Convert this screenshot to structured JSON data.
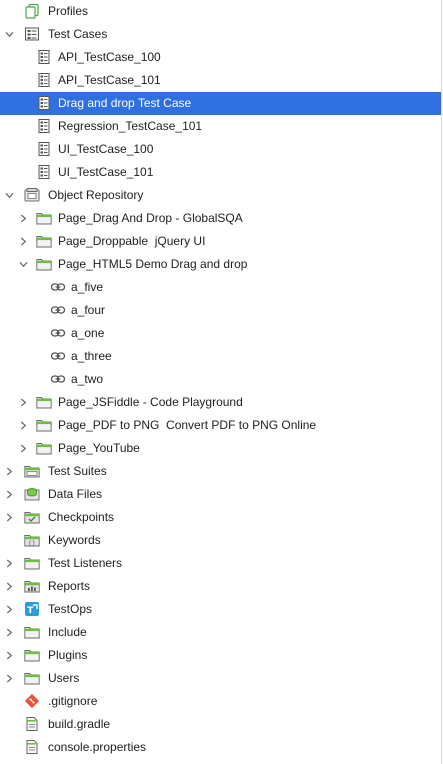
{
  "selection_color": "#2f6fe0",
  "tree": [
    {
      "label": "Profiles",
      "icon": "profiles-icon",
      "level": 0,
      "chevron": "none"
    },
    {
      "label": "Test Cases",
      "icon": "test-cases-folder-icon",
      "level": 0,
      "chevron": "down"
    },
    {
      "label": "API_TestCase_100",
      "icon": "test-case-icon",
      "level": 1,
      "chevron": "none"
    },
    {
      "label": "API_TestCase_101",
      "icon": "test-case-icon",
      "level": 1,
      "chevron": "none"
    },
    {
      "label": "Drag and drop Test Case",
      "icon": "test-case-icon",
      "level": 1,
      "chevron": "none",
      "selected": true
    },
    {
      "label": "Regression_TestCase_101",
      "icon": "test-case-icon",
      "level": 1,
      "chevron": "none"
    },
    {
      "label": "UI_TestCase_100",
      "icon": "test-case-icon",
      "level": 1,
      "chevron": "none"
    },
    {
      "label": "UI_TestCase_101",
      "icon": "test-case-icon",
      "level": 1,
      "chevron": "none"
    },
    {
      "label": "Object Repository",
      "icon": "object-repository-icon",
      "level": 0,
      "chevron": "down"
    },
    {
      "label": "Page_Drag And Drop - GlobalSQA",
      "icon": "folder-icon",
      "level": 1,
      "chevron": "right"
    },
    {
      "label": "Page_Droppable  jQuery UI",
      "icon": "folder-icon",
      "level": 1,
      "chevron": "right"
    },
    {
      "label": "Page_HTML5 Demo Drag and drop",
      "icon": "folder-icon",
      "level": 1,
      "chevron": "down"
    },
    {
      "label": "a_five",
      "icon": "link-icon",
      "level": 2,
      "chevron": "none"
    },
    {
      "label": "a_four",
      "icon": "link-icon",
      "level": 2,
      "chevron": "none"
    },
    {
      "label": "a_one",
      "icon": "link-icon",
      "level": 2,
      "chevron": "none"
    },
    {
      "label": "a_three",
      "icon": "link-icon",
      "level": 2,
      "chevron": "none"
    },
    {
      "label": "a_two",
      "icon": "link-icon",
      "level": 2,
      "chevron": "none"
    },
    {
      "label": "Page_JSFiddle - Code Playground",
      "icon": "folder-icon",
      "level": 1,
      "chevron": "right"
    },
    {
      "label": "Page_PDF to PNG  Convert PDF to PNG Online",
      "icon": "folder-icon",
      "level": 1,
      "chevron": "right"
    },
    {
      "label": "Page_YouTube",
      "icon": "folder-icon",
      "level": 1,
      "chevron": "right"
    },
    {
      "label": "Test Suites",
      "icon": "test-suites-icon",
      "level": 0,
      "chevron": "right"
    },
    {
      "label": "Data Files",
      "icon": "data-files-icon",
      "level": 0,
      "chevron": "right"
    },
    {
      "label": "Checkpoints",
      "icon": "checkpoints-icon",
      "level": 0,
      "chevron": "right"
    },
    {
      "label": "Keywords",
      "icon": "keywords-icon",
      "level": 0,
      "chevron": "none"
    },
    {
      "label": "Test Listeners",
      "icon": "folder-icon",
      "level": 0,
      "chevron": "right"
    },
    {
      "label": "Reports",
      "icon": "reports-icon",
      "level": 0,
      "chevron": "right"
    },
    {
      "label": "TestOps",
      "icon": "testops-icon",
      "level": 0,
      "chevron": "right"
    },
    {
      "label": "Include",
      "icon": "folder-icon",
      "level": 0,
      "chevron": "right"
    },
    {
      "label": "Plugins",
      "icon": "folder-icon",
      "level": 0,
      "chevron": "right"
    },
    {
      "label": "Users",
      "icon": "folder-icon",
      "level": 0,
      "chevron": "right"
    },
    {
      "label": ".gitignore",
      "icon": "git-icon",
      "level": 0,
      "chevron": "none"
    },
    {
      "label": "build.gradle",
      "icon": "file-icon",
      "level": 0,
      "chevron": "none"
    },
    {
      "label": "console.properties",
      "icon": "file-icon",
      "level": 0,
      "chevron": "none"
    }
  ]
}
